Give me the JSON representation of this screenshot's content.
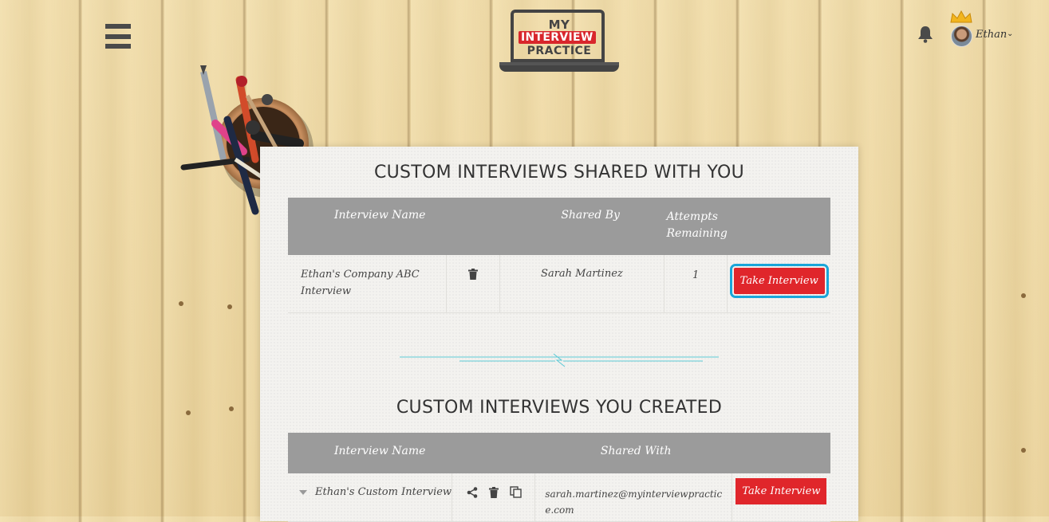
{
  "header": {
    "logo_line1": "MY",
    "logo_line2": "INTERVIEW",
    "logo_line3": "PRACTICE",
    "username": "Ethan"
  },
  "shared_section": {
    "title": "CUSTOM INTERVIEWS SHARED WITH YOU",
    "columns": [
      "Interview Name",
      "",
      "Shared By",
      "Attempts Remaining",
      ""
    ],
    "rows": [
      {
        "name": "Ethan's Company ABC Interview",
        "shared_by": "Sarah Martinez",
        "attempts": "1",
        "action": "Take Interview"
      }
    ]
  },
  "created_section": {
    "title": "CUSTOM INTERVIEWS YOU CREATED",
    "columns": [
      "Interview Name",
      "",
      "Shared With",
      ""
    ],
    "rows": [
      {
        "name": "Ethan's Custom Interview",
        "shared_with": "sarah.martinez@myinterviewpractice.com",
        "action": "Take Interview"
      }
    ]
  },
  "icons": {
    "menu": "hamburger-icon",
    "bell": "bell-icon",
    "trash": "trash-icon",
    "share": "share-icon",
    "copy": "copy-icon",
    "expand": "caret-down-icon",
    "user_caret": "chevron-down-icon",
    "crown": "crown-icon"
  },
  "colors": {
    "accent_red": "#e0262b",
    "header_gray": "#9b9b9b",
    "focus_blue": "#1aa6d9",
    "divider_teal": "#5cc9d6"
  }
}
